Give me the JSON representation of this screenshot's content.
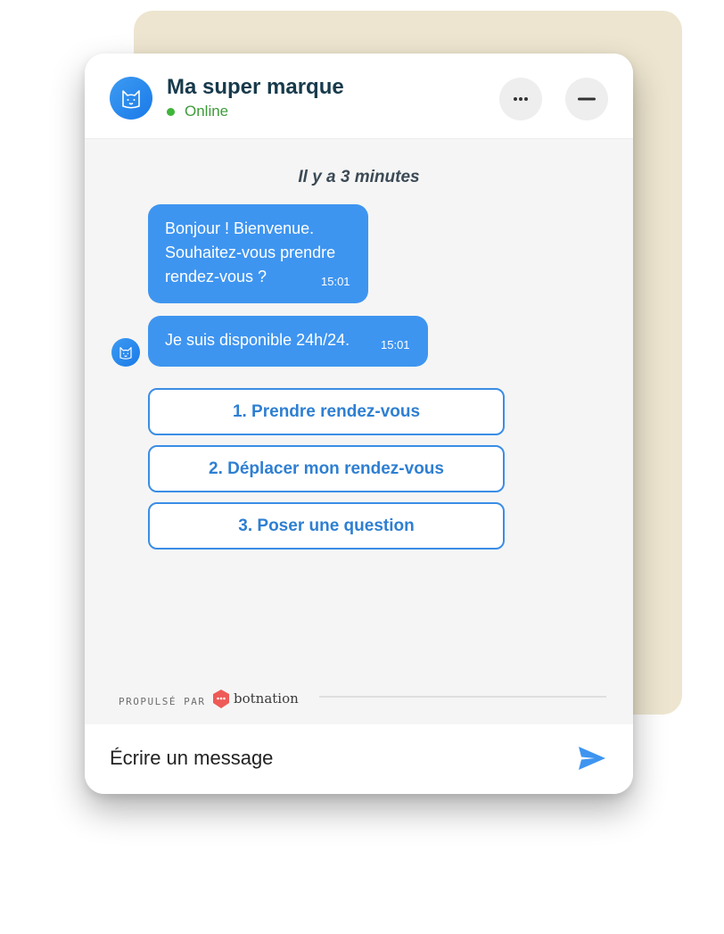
{
  "header": {
    "title": "Ma super marque",
    "status": "Online",
    "more_icon": "more-horizontal-icon",
    "minimize_icon": "minimize-icon"
  },
  "conversation": {
    "timestamp_label": "Il y a 3 minutes",
    "messages": [
      {
        "text": "Bonjour ! Bienvenue. Souhaitez-vous prendre rendez-vous ?",
        "time": "15:01"
      },
      {
        "text": "Je suis disponible 24h/24.",
        "time": "15:01"
      }
    ],
    "choices": [
      {
        "label": "1. Prendre rendez-vous"
      },
      {
        "label": "2. Déplacer mon rendez-vous"
      },
      {
        "label": "3. Poser une question"
      }
    ]
  },
  "footer": {
    "powered_by": "PROPULSÉ PAR",
    "brand": "botnation"
  },
  "composer": {
    "placeholder": "Écrire un message",
    "send_icon": "send-icon"
  },
  "colors": {
    "accent": "#3e95f0",
    "title": "#173a4c",
    "online": "#3fb53a",
    "backdrop": "#ede5cf",
    "brand_mark": "#ee5a57"
  }
}
